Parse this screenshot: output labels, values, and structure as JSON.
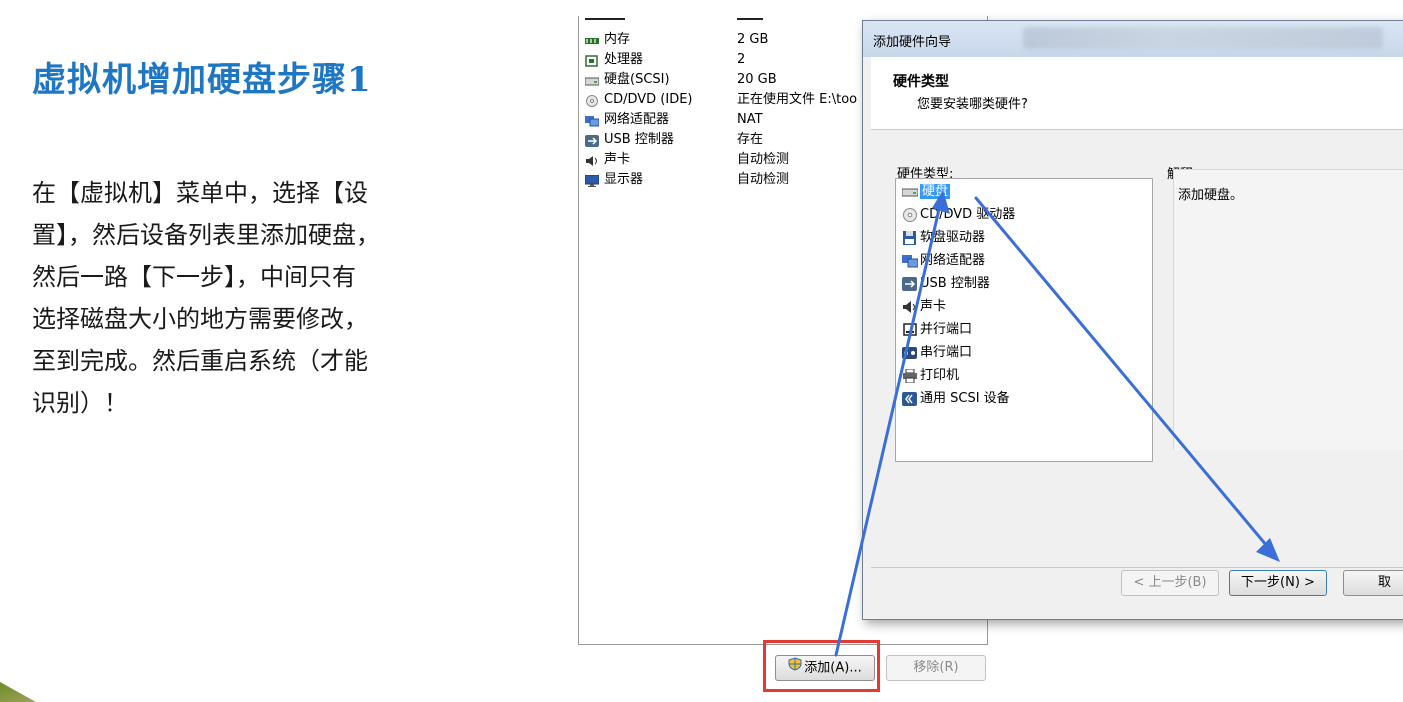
{
  "slide": {
    "title": "虚拟机增加硬盘步骤1",
    "body_lines": [
      "在【虚拟机】菜单中，选择【设",
      "置】，然后设备列表里添加硬盘，",
      "然后一路【下一步】，中间只有",
      "选择磁盘大小的地方需要修改，",
      "至到完成。然后重启系统（才能",
      "识别）！"
    ]
  },
  "device_list": {
    "devices": [
      {
        "icon": "memory-icon",
        "name": "内存",
        "value": "2 GB"
      },
      {
        "icon": "cpu-icon",
        "name": "处理器",
        "value": "2"
      },
      {
        "icon": "harddisk-icon",
        "name": "硬盘(SCSI)",
        "value": "20 GB"
      },
      {
        "icon": "cd-icon",
        "name": "CD/DVD (IDE)",
        "value": "正在使用文件 E:\\too"
      },
      {
        "icon": "network-icon",
        "name": "网络适配器",
        "value": "NAT"
      },
      {
        "icon": "usb-icon",
        "name": "USB 控制器",
        "value": "存在"
      },
      {
        "icon": "sound-icon",
        "name": "声卡",
        "value": "自动检测"
      },
      {
        "icon": "display-icon",
        "name": "显示器",
        "value": "自动检测"
      }
    ],
    "add_button": "添加(A)...",
    "remove_button": "移除(R)"
  },
  "wizard": {
    "title": "添加硬件向导",
    "header_title": "硬件类型",
    "header_subtitle": "您要安装哪类硬件?",
    "list_label": "硬件类型:",
    "explain_label": "解释",
    "explain_text": "添加硬盘。",
    "hardware_types": [
      {
        "icon": "harddisk-icon",
        "label": "硬盘",
        "selected": true
      },
      {
        "icon": "cd-icon",
        "label": "CD/DVD 驱动器",
        "selected": false
      },
      {
        "icon": "floppy-icon",
        "label": "软盘驱动器",
        "selected": false
      },
      {
        "icon": "network-icon",
        "label": "网络适配器",
        "selected": false
      },
      {
        "icon": "usb-icon",
        "label": "USB 控制器",
        "selected": false
      },
      {
        "icon": "sound-icon",
        "label": "声卡",
        "selected": false
      },
      {
        "icon": "parallel-port-icon",
        "label": "并行端口",
        "selected": false
      },
      {
        "icon": "serial-port-icon",
        "label": "串行端口",
        "selected": false
      },
      {
        "icon": "printer-icon",
        "label": "打印机",
        "selected": false
      },
      {
        "icon": "scsi-icon",
        "label": "通用 SCSI 设备",
        "selected": false
      }
    ],
    "back_button": "< 上一步(B)",
    "next_button": "下一步(N) >",
    "cancel_button": "取"
  },
  "colors": {
    "title_blue": "#1f77c4",
    "arrow_blue": "#3a6fd8",
    "highlight_red": "#e53935",
    "selection_blue": "#3399ff"
  }
}
